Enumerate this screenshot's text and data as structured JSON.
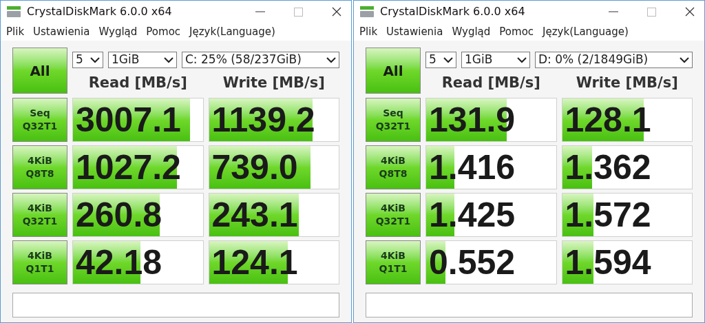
{
  "windows": [
    {
      "title": "CrystalDiskMark 6.0.0 x64",
      "menu": [
        "Plik",
        "Ustawienia",
        "Wygląd",
        "Pomoc",
        "Język(Language)"
      ],
      "all_button": "All",
      "count": "5",
      "size": "1GiB",
      "drive": "C: 25% (58/237GiB)",
      "headers": [
        "Read [MB/s]",
        "Write [MB/s]"
      ],
      "rows": [
        {
          "test": [
            "Seq",
            "Q32T1"
          ],
          "read": {
            "value": "3007.1",
            "level": 0.9
          },
          "write": {
            "value": "1139.2",
            "level": 0.8
          }
        },
        {
          "test": [
            "4KiB",
            "Q8T8"
          ],
          "read": {
            "value": "1027.2",
            "level": 0.8
          },
          "write": {
            "value": "739.0",
            "level": 0.78
          }
        },
        {
          "test": [
            "4KiB",
            "Q32T1"
          ],
          "read": {
            "value": "260.8",
            "level": 0.67
          },
          "write": {
            "value": "243.1",
            "level": 0.69
          }
        },
        {
          "test": [
            "4KiB",
            "Q1T1"
          ],
          "read": {
            "value": "42.18",
            "level": 0.52
          },
          "write": {
            "value": "124.1",
            "level": 0.61
          }
        }
      ]
    },
    {
      "title": "CrystalDiskMark 6.0.0 x64",
      "menu": [
        "Plik",
        "Ustawienia",
        "Wygląd",
        "Pomoc",
        "Język(Language)"
      ],
      "all_button": "All",
      "count": "5",
      "size": "1GiB",
      "drive": "D: 0% (2/1849GiB)",
      "headers": [
        "Read [MB/s]",
        "Write [MB/s]"
      ],
      "rows": [
        {
          "test": [
            "Seq",
            "Q32T1"
          ],
          "read": {
            "value": "131.9",
            "level": 0.62
          },
          "write": {
            "value": "128.1",
            "level": 0.63
          }
        },
        {
          "test": [
            "4KiB",
            "Q8T8"
          ],
          "read": {
            "value": "1.416",
            "level": 0.22
          },
          "write": {
            "value": "1.362",
            "level": 0.23
          }
        },
        {
          "test": [
            "4KiB",
            "Q32T1"
          ],
          "read": {
            "value": "1.425",
            "level": 0.22
          },
          "write": {
            "value": "1.572",
            "level": 0.24
          }
        },
        {
          "test": [
            "4KiB",
            "Q1T1"
          ],
          "read": {
            "value": "0.552",
            "level": 0.15
          },
          "write": {
            "value": "1.594",
            "level": 0.24
          }
        }
      ]
    }
  ]
}
